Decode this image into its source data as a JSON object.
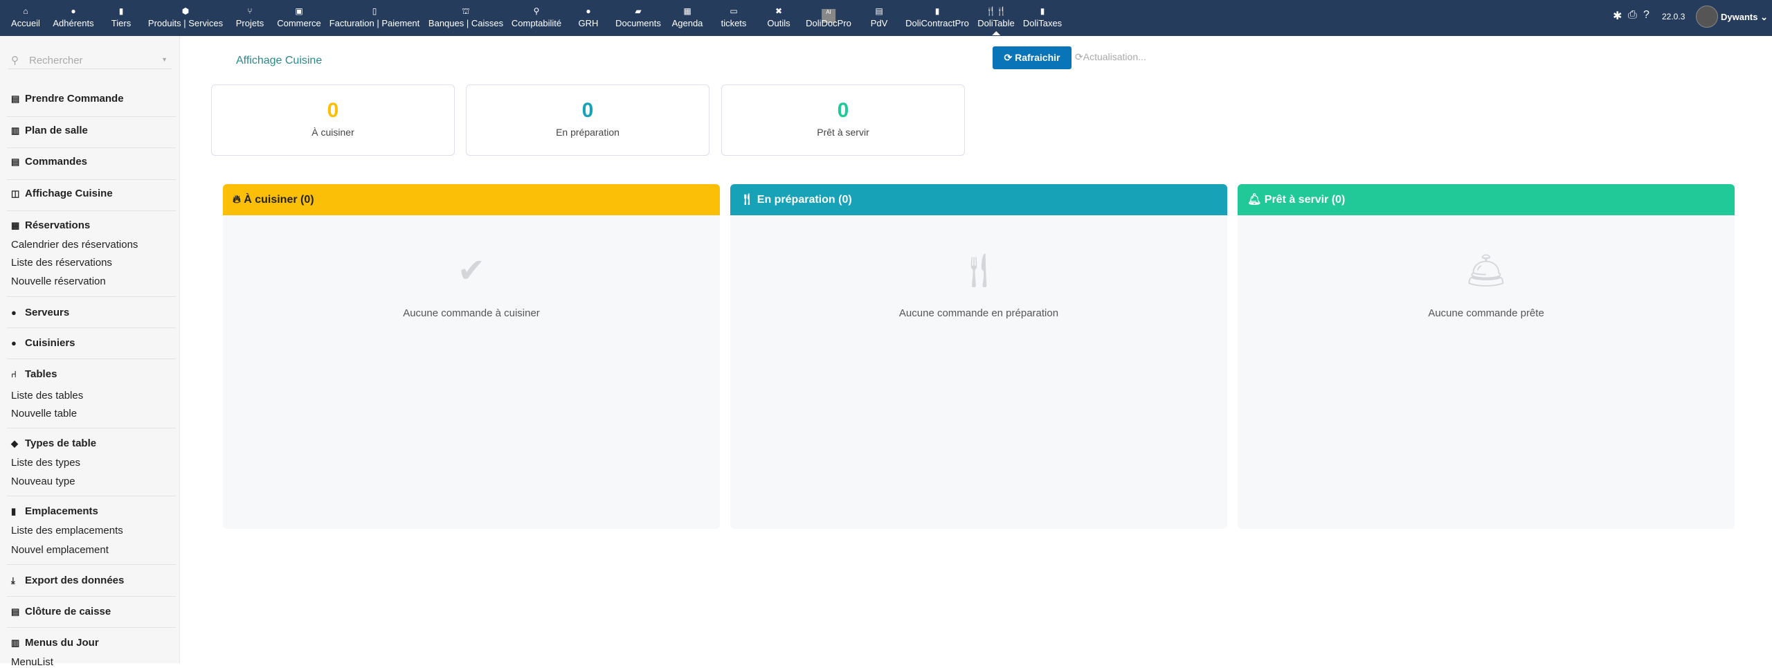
{
  "topbar": {
    "items": [
      {
        "label": "Accueil",
        "icon": "home-icon",
        "glyph": "⌂"
      },
      {
        "label": "Adhérents",
        "icon": "member-icon",
        "glyph": "●"
      },
      {
        "label": "Tiers",
        "icon": "building-icon",
        "glyph": "▮"
      },
      {
        "label": "Produits | Services",
        "icon": "cube-icon",
        "glyph": "⬢"
      },
      {
        "label": "Projets",
        "icon": "project-icon",
        "glyph": "⑂"
      },
      {
        "label": "Commerce",
        "icon": "briefcase-icon",
        "glyph": "▣"
      },
      {
        "label": "Facturation | Paiement",
        "icon": "invoice-icon",
        "glyph": "▯"
      },
      {
        "label": "Banques | Caisses",
        "icon": "bank-icon",
        "glyph": "⛫"
      },
      {
        "label": "Comptabilité",
        "icon": "search-dollar-icon",
        "glyph": "⚲"
      },
      {
        "label": "GRH",
        "icon": "user-tie-icon",
        "glyph": "●"
      },
      {
        "label": "Documents",
        "icon": "folder-icon",
        "glyph": "▰"
      },
      {
        "label": "Agenda",
        "icon": "calendar-icon",
        "glyph": "▦"
      },
      {
        "label": "tickets",
        "icon": "ticket-icon",
        "glyph": "▭"
      },
      {
        "label": "Outils",
        "icon": "tools-icon",
        "glyph": "✖"
      },
      {
        "label": "DoliDocPro",
        "icon": "ai-icon",
        "glyph": "AI"
      },
      {
        "label": "PdV",
        "icon": "cash-register-icon",
        "glyph": "▤"
      },
      {
        "label": "DoliContractPro",
        "icon": "file-icon",
        "glyph": "▮"
      },
      {
        "label": "DoliTable",
        "icon": "utensils-icon",
        "glyph": "🍴🍴"
      },
      {
        "label": "DoliTaxes",
        "icon": "file-icon",
        "glyph": "▮"
      }
    ],
    "version": "22.0.3",
    "user": "Dywants"
  },
  "sidebar": {
    "search_placeholder": "Rechercher",
    "sections": {
      "prendre": "Prendre Commande",
      "plan": "Plan de salle",
      "commandes": "Commandes",
      "affichage": "Affichage Cuisine",
      "reservations": "Réservations",
      "res1": "Calendrier des réservations",
      "res2": "Liste des réservations",
      "res3": "Nouvelle réservation",
      "serveurs": "Serveurs",
      "cuisiniers": "Cuisiniers",
      "tables": "Tables",
      "tab1": "Liste des tables",
      "tab2": "Nouvelle table",
      "types": "Types de table",
      "typ1": "Liste des types",
      "typ2": "Nouveau type",
      "emplacements": "Emplacements",
      "emp1": "Liste des emplacements",
      "emp2": "Nouvel emplacement",
      "export": "Export des données",
      "cloture": "Clôture de caisse",
      "menus": "Menus du Jour",
      "menu1": "MenuList"
    }
  },
  "main": {
    "title": "Affichage Cuisine",
    "refresh_label": "Rafraichir",
    "updating": "Actualisation...",
    "stats": [
      {
        "value": "0",
        "label": "À cuisiner",
        "color": "#fcbf07"
      },
      {
        "value": "0",
        "label": "En préparation",
        "color": "#17a2b8"
      },
      {
        "value": "0",
        "label": "Prêt à servir",
        "color": "#20c997"
      }
    ],
    "columns": [
      {
        "header": "À cuisiner (0)",
        "empty": "Aucune commande à cuisiner",
        "color": "#fcbf07"
      },
      {
        "header": "En préparation (0)",
        "empty": "Aucune commande en préparation",
        "color": "#17a2b8"
      },
      {
        "header": "Prêt à servir (0)",
        "empty": "Aucune commande prête",
        "color": "#20c997"
      }
    ]
  }
}
